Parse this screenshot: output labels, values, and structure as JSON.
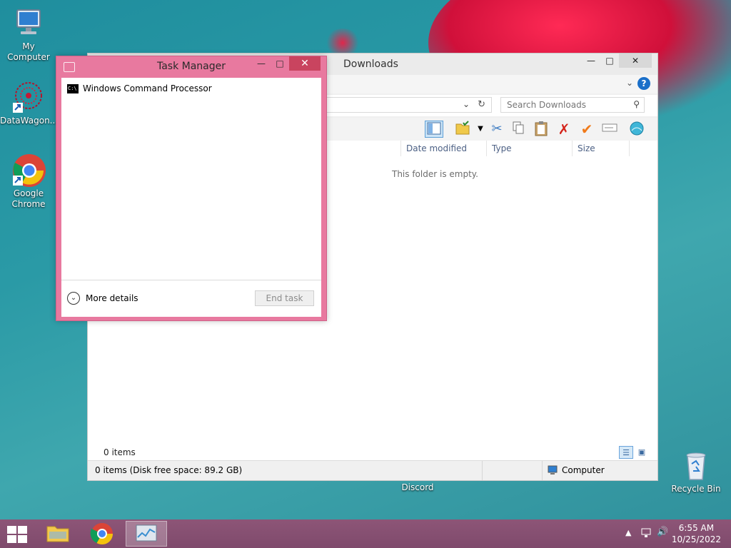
{
  "desktop": {
    "icons": [
      {
        "label": "My Computer"
      },
      {
        "label": "DataWagon..."
      },
      {
        "label": "Google Chrome"
      },
      {
        "label": "Discord"
      },
      {
        "label": "Recycle Bin"
      }
    ]
  },
  "explorer": {
    "title": "Downloads",
    "search_placeholder": "Search Downloads",
    "columns": [
      "Date modified",
      "Type",
      "Size"
    ],
    "empty_message": "This folder is empty.",
    "items_count": "0 items",
    "status_left": "0 items (Disk free space: 89.2 GB)",
    "status_right": "Computer"
  },
  "task_manager": {
    "title": "Task Manager",
    "processes": [
      "Windows Command Processor"
    ],
    "more_details": "More details",
    "end_task": "End task"
  },
  "taskbar": {
    "apps": [
      "file-explorer",
      "google-chrome",
      "task-manager"
    ],
    "time": "6:55 AM",
    "date": "10/25/2022"
  },
  "colors": {
    "task_manager_accent": "#e8799f",
    "taskbar": "#8d5577",
    "desktop": "#2a9aa6"
  }
}
